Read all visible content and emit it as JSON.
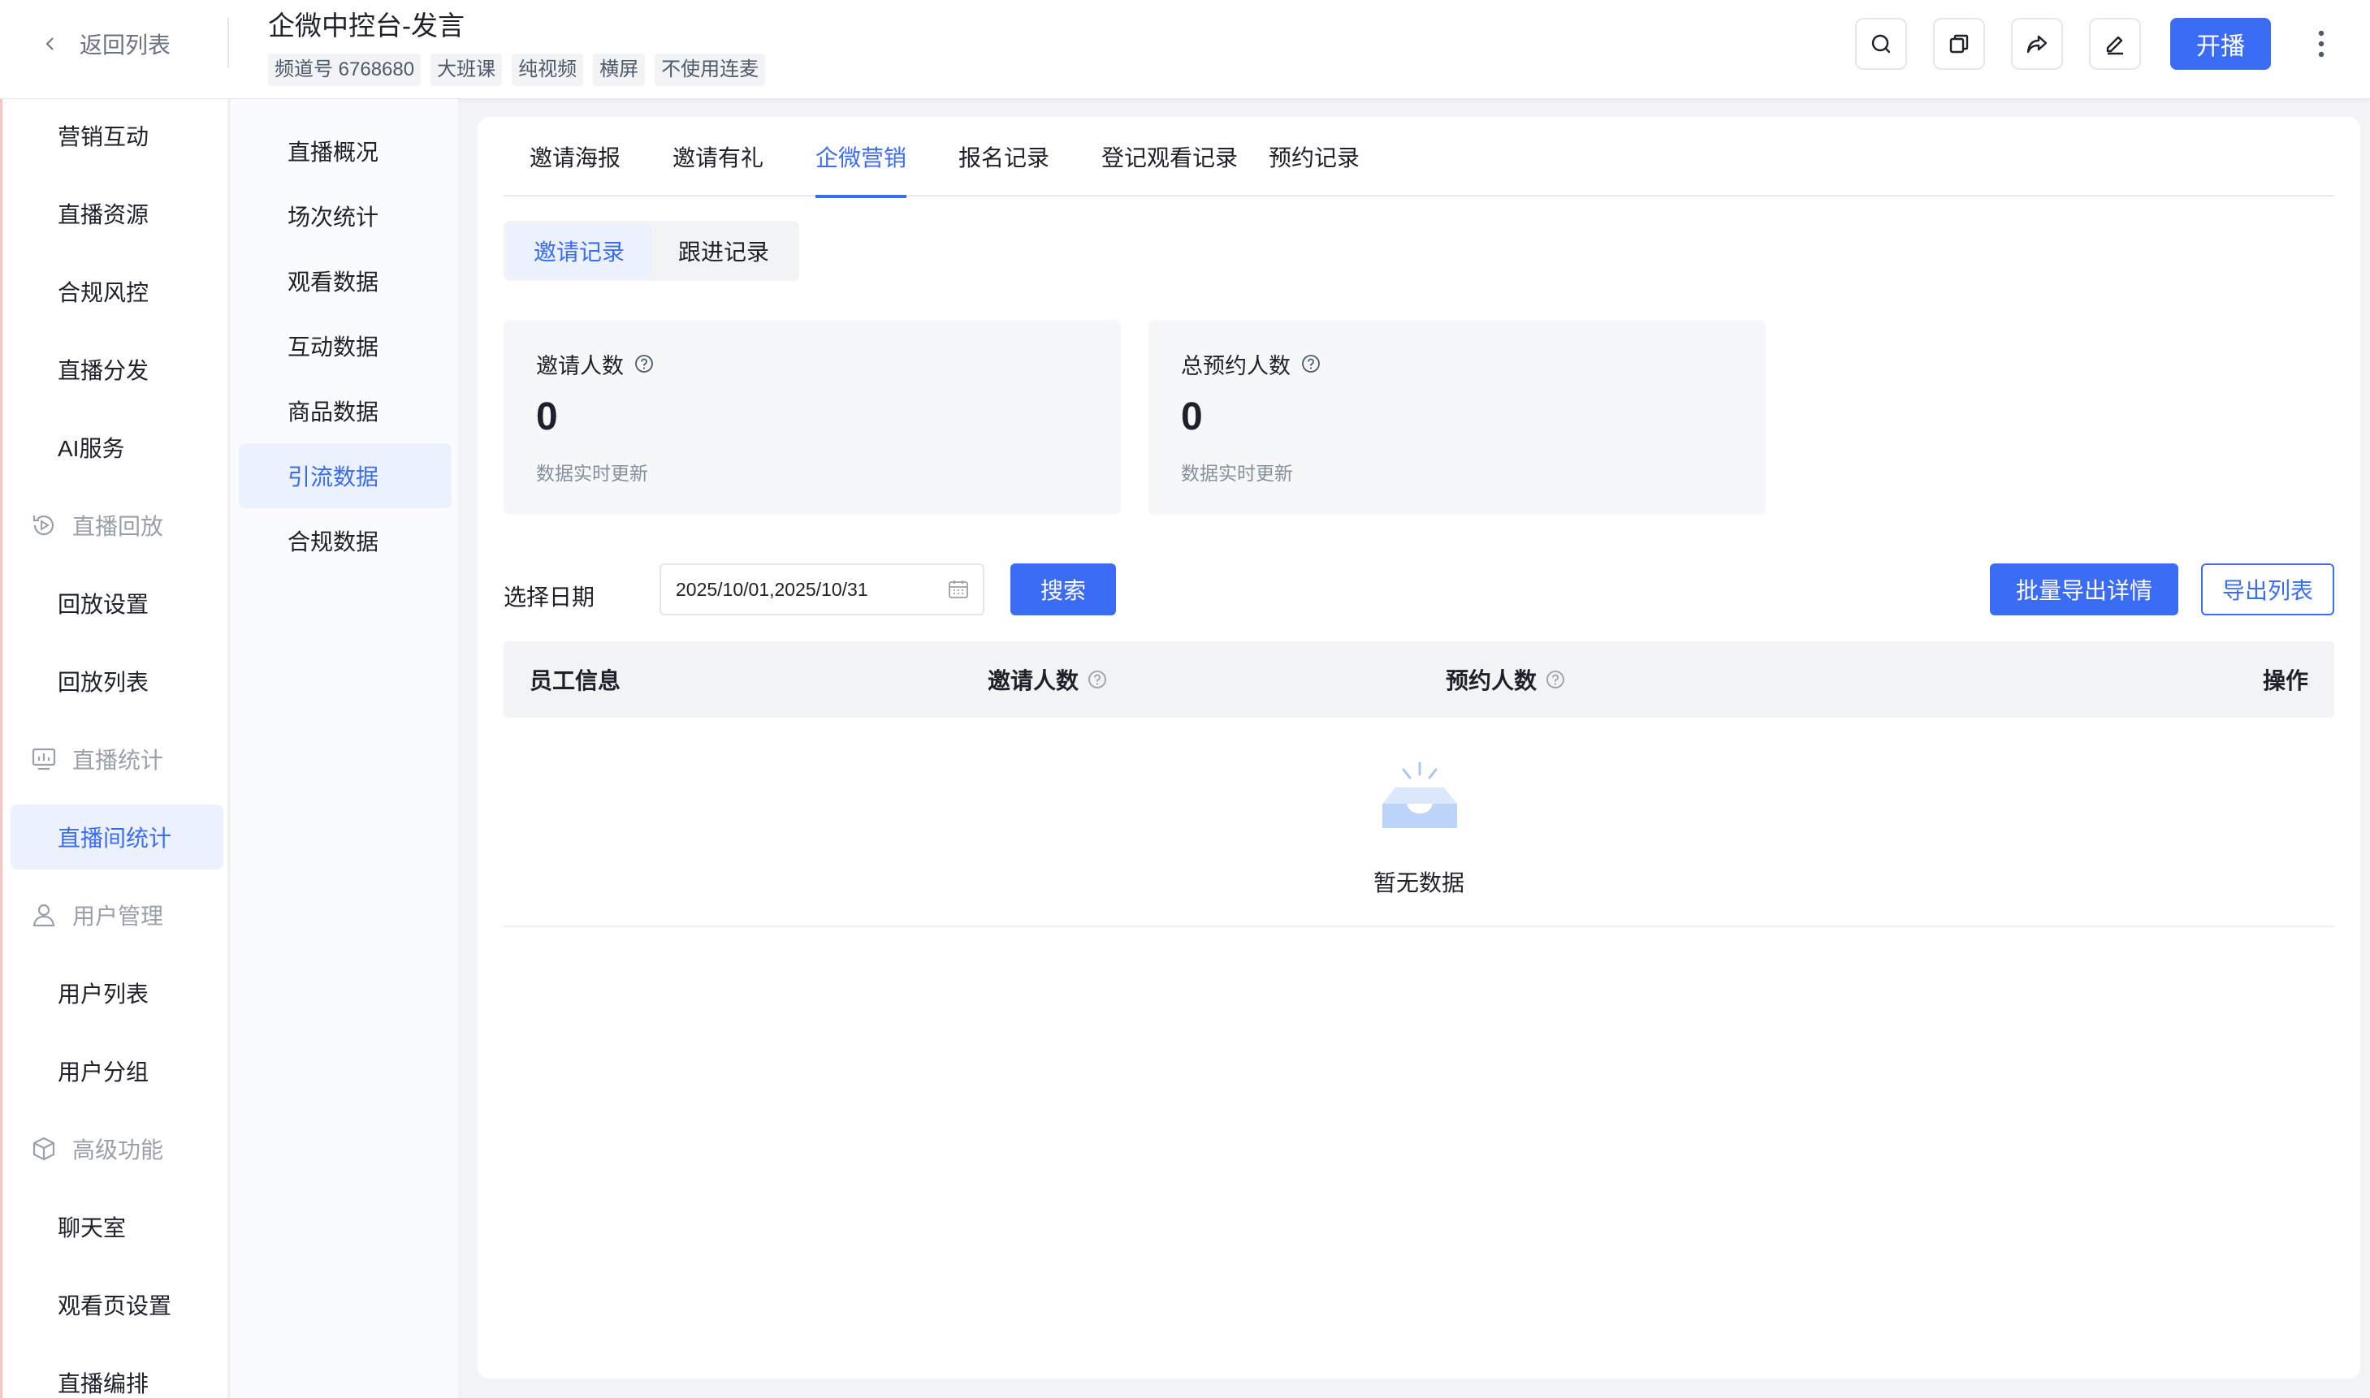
{
  "header": {
    "back_label": "返回列表",
    "title": "企微中控台-发言",
    "tags": [
      "频道号 6768680",
      "大班课",
      "纯视频",
      "横屏",
      "不使用连麦"
    ],
    "start_label": "开播"
  },
  "sidebar": {
    "items": [
      {
        "label": "营销互动"
      },
      {
        "label": "直播资源"
      },
      {
        "label": "合规风控"
      },
      {
        "label": "直播分发"
      },
      {
        "label": "AI服务"
      },
      {
        "label": "直播回放"
      },
      {
        "label": "回放设置"
      },
      {
        "label": "回放列表"
      },
      {
        "label": "直播统计"
      },
      {
        "label": "直播间统计"
      },
      {
        "label": "用户管理"
      },
      {
        "label": "用户列表"
      },
      {
        "label": "用户分组"
      },
      {
        "label": "高级功能"
      },
      {
        "label": "聊天室"
      },
      {
        "label": "观看页设置"
      },
      {
        "label": "直播编排"
      }
    ]
  },
  "subnav": {
    "items": [
      {
        "label": "直播概况"
      },
      {
        "label": "场次统计"
      },
      {
        "label": "观看数据"
      },
      {
        "label": "互动数据"
      },
      {
        "label": "商品数据"
      },
      {
        "label": "引流数据"
      },
      {
        "label": "合规数据"
      }
    ]
  },
  "main": {
    "tabs": [
      {
        "label": "邀请海报"
      },
      {
        "label": "邀请有礼"
      },
      {
        "label": "企微营销"
      },
      {
        "label": "报名记录"
      },
      {
        "label": "登记观看记录"
      },
      {
        "label": "预约记录"
      }
    ],
    "segments": [
      {
        "label": "邀请记录"
      },
      {
        "label": "跟进记录"
      }
    ],
    "stats": [
      {
        "label": "邀请人数",
        "value": "0",
        "note": "数据实时更新"
      },
      {
        "label": "总预约人数",
        "value": "0",
        "note": "数据实时更新"
      }
    ],
    "filter": {
      "date_label": "选择日期",
      "date_value": "2025/10/01,2025/10/31",
      "search_label": "搜索",
      "batch_export_label": "批量导出详情",
      "export_list_label": "导出列表"
    },
    "table": {
      "columns": [
        "员工信息",
        "邀请人数",
        "预约人数",
        "操作"
      ],
      "empty_text": "暂无数据"
    }
  },
  "colors": {
    "accent": "#3b6cf6",
    "accent_bg": "#ecf1fe",
    "text": "#1d2129",
    "muted": "#86909c"
  }
}
